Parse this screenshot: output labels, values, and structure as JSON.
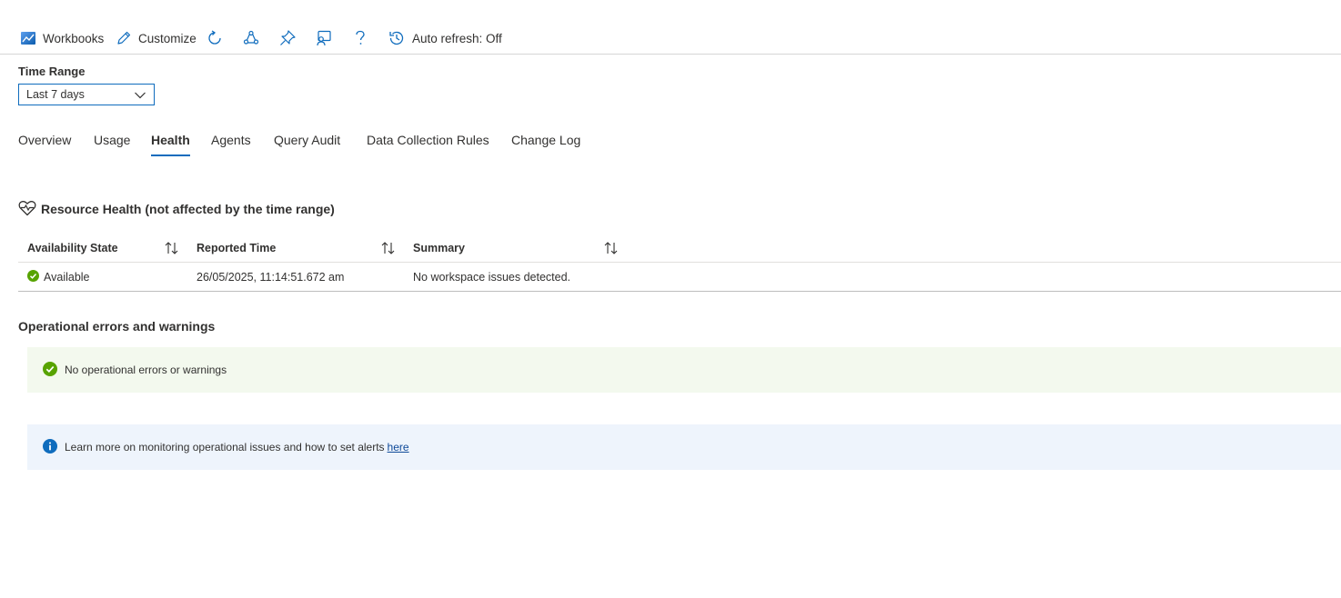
{
  "toolbar": {
    "workbooks_label": "Workbooks",
    "customize_label": "Customize",
    "auto_refresh_label": "Auto refresh: Off",
    "icons": [
      "workbooks-icon",
      "edit-pencil-icon",
      "refresh-icon",
      "share-icon",
      "pin-icon",
      "feedback-icon",
      "help-icon",
      "history-icon"
    ]
  },
  "time_range": {
    "label": "Time Range",
    "selected": "Last 7 days"
  },
  "tabs": [
    {
      "label": "Overview",
      "active": false
    },
    {
      "label": "Usage",
      "active": false
    },
    {
      "label": "Health",
      "active": true
    },
    {
      "label": "Agents",
      "active": false
    },
    {
      "label": "Query Audit",
      "active": false
    },
    {
      "label": "Data Collection Rules",
      "active": false
    },
    {
      "label": "Change Log",
      "active": false
    }
  ],
  "resource_health": {
    "title": "Resource Health (not affected by the time range)",
    "columns": [
      "Availability State",
      "Reported Time",
      "Summary"
    ],
    "rows": [
      {
        "availability_state": "Available",
        "reported_time": "26/05/2025, 11:14:51.672 am",
        "summary": "No workspace issues detected."
      }
    ]
  },
  "operational": {
    "title": "Operational errors and warnings",
    "ok_message": "No operational errors or warnings",
    "info_message": "Learn more on monitoring operational issues and how to set alerts",
    "info_link": "here"
  },
  "colors": {
    "accent": "#0f6cbd",
    "success": "#57a300",
    "info": "#0f6cbd",
    "ok_banner_bg": "#f3f9ee",
    "info_banner_bg": "#eef4fc"
  }
}
